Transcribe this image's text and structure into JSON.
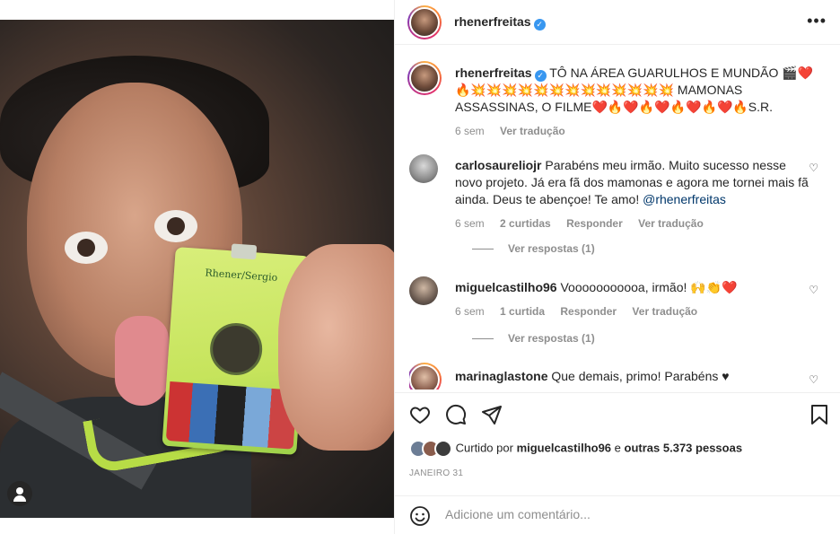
{
  "post": {
    "author": "rhenerfreitas",
    "verified": true,
    "more_icon": "more-horizontal-icon"
  },
  "caption": {
    "text": "TÔ NA ÁREA GUARULHOS E MUNDÃO 🎬❤️🔥💥💥💥💥💥💥💥💥💥💥💥💥💥 MAMONAS ASSASSINAS, O FILME❤️🔥❤️🔥❤️🔥❤️🔥❤️🔥S.R.",
    "time": "6 sem",
    "translate": "Ver tradução"
  },
  "comments": [
    {
      "user": "carlosaureliojr",
      "text": "Parabéns meu irmão. Muito sucesso nesse novo projeto. Já era fã dos mamonas e agora me tornei mais fã ainda. Deus te abençoe! Te amo! ",
      "mention": "@rhenerfreitas",
      "time": "6 sem",
      "likes": "2 curtidas",
      "reply": "Responder",
      "translate": "Ver tradução",
      "view_replies": "Ver respostas (1)"
    },
    {
      "user": "miguelcastilho96",
      "text": "Vooooooooooa, irmão! 🙌👏❤️",
      "time": "6 sem",
      "likes": "1 curtida",
      "reply": "Responder",
      "translate": "Ver tradução",
      "view_replies": "Ver respostas (1)"
    },
    {
      "user": "marinaglastone",
      "text": "Que demais, primo! Parabéns ♥"
    }
  ],
  "likes": {
    "prefix": "Curtido por",
    "user": "miguelcastilho96",
    "middle": "e",
    "others": "outras 5.373 pessoas"
  },
  "date": "JANEIRO 31",
  "comment_input": {
    "placeholder": "Adicione um comentário...",
    "emoji_icon": "smiley-icon"
  },
  "photo": {
    "badge_name": "Rhener/Sergio"
  },
  "colors": {
    "link": "#00376b",
    "verified": "#3897f0",
    "muted": "#8e8e8e"
  }
}
